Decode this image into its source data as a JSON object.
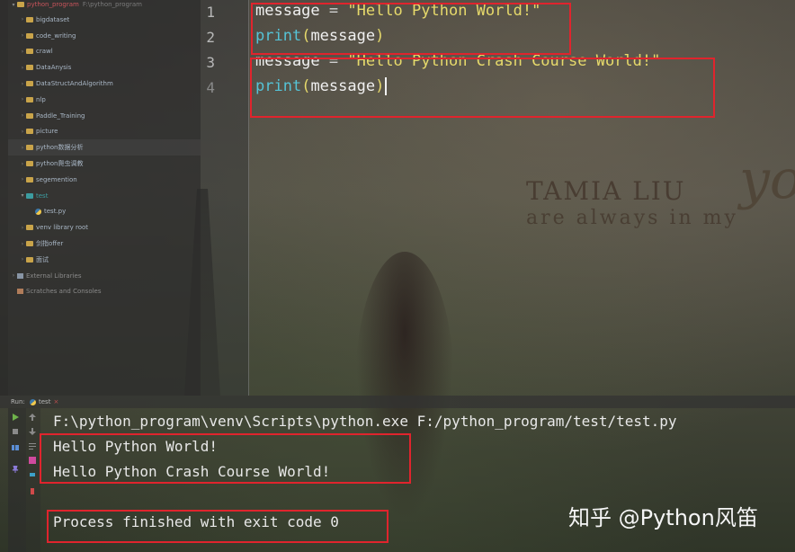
{
  "project_tree": {
    "root": {
      "name": "python_program",
      "path": "F:\\python_program"
    },
    "items": [
      {
        "label": "bigdataset",
        "type": "folder"
      },
      {
        "label": "code_writing",
        "type": "folder"
      },
      {
        "label": "crawl",
        "type": "folder"
      },
      {
        "label": "DataAnysis",
        "type": "folder"
      },
      {
        "label": "DataStructAndAlgorithm",
        "type": "folder"
      },
      {
        "label": "nlp",
        "type": "folder"
      },
      {
        "label": "Paddle_Training",
        "type": "folder"
      },
      {
        "label": "picture",
        "type": "folder"
      },
      {
        "label": "python数据分析",
        "type": "folder"
      },
      {
        "label": "python爬虫调教",
        "type": "folder"
      },
      {
        "label": "segemention",
        "type": "folder"
      },
      {
        "label": "test",
        "type": "folder-open"
      },
      {
        "label": "test.py",
        "type": "python-file"
      },
      {
        "label": "venv  library root",
        "type": "folder"
      },
      {
        "label": "剑指offer",
        "type": "folder"
      },
      {
        "label": "面试",
        "type": "folder"
      },
      {
        "label": "External Libraries",
        "type": "library"
      },
      {
        "label": "Scratches and Consoles",
        "type": "scratch"
      }
    ]
  },
  "editor": {
    "line_numbers": [
      "1",
      "2",
      "3",
      "4"
    ],
    "lines": [
      {
        "var": "message",
        "op": " = ",
        "str": "\"Hello Python World!\""
      },
      {
        "fn": "print",
        "open": "(",
        "arg": "message",
        "close": ")"
      },
      {
        "var": "message",
        "op": " = ",
        "str": "\"Hello Python Crash Course World!\""
      },
      {
        "fn": "print",
        "open": "(",
        "arg": "message",
        "close": ")"
      }
    ]
  },
  "run_panel": {
    "label": "Run:",
    "tab_label": "test",
    "tab_close": "×",
    "console": [
      "F:\\python_program\\venv\\Scripts\\python.exe F:/python_program/test/test.py",
      "Hello Python World!",
      "Hello Python Crash Course World!",
      "",
      "Process finished with exit code 0"
    ]
  },
  "watermark": {
    "brand": "TAMIA LIU",
    "tagline": "are always in my",
    "script": "yo",
    "zhihu": "知乎 @Python风笛"
  },
  "colors": {
    "highlight": "#e0242d",
    "string": "#e6d96b",
    "function": "#55c3d6",
    "project_root": "#c8545b"
  }
}
